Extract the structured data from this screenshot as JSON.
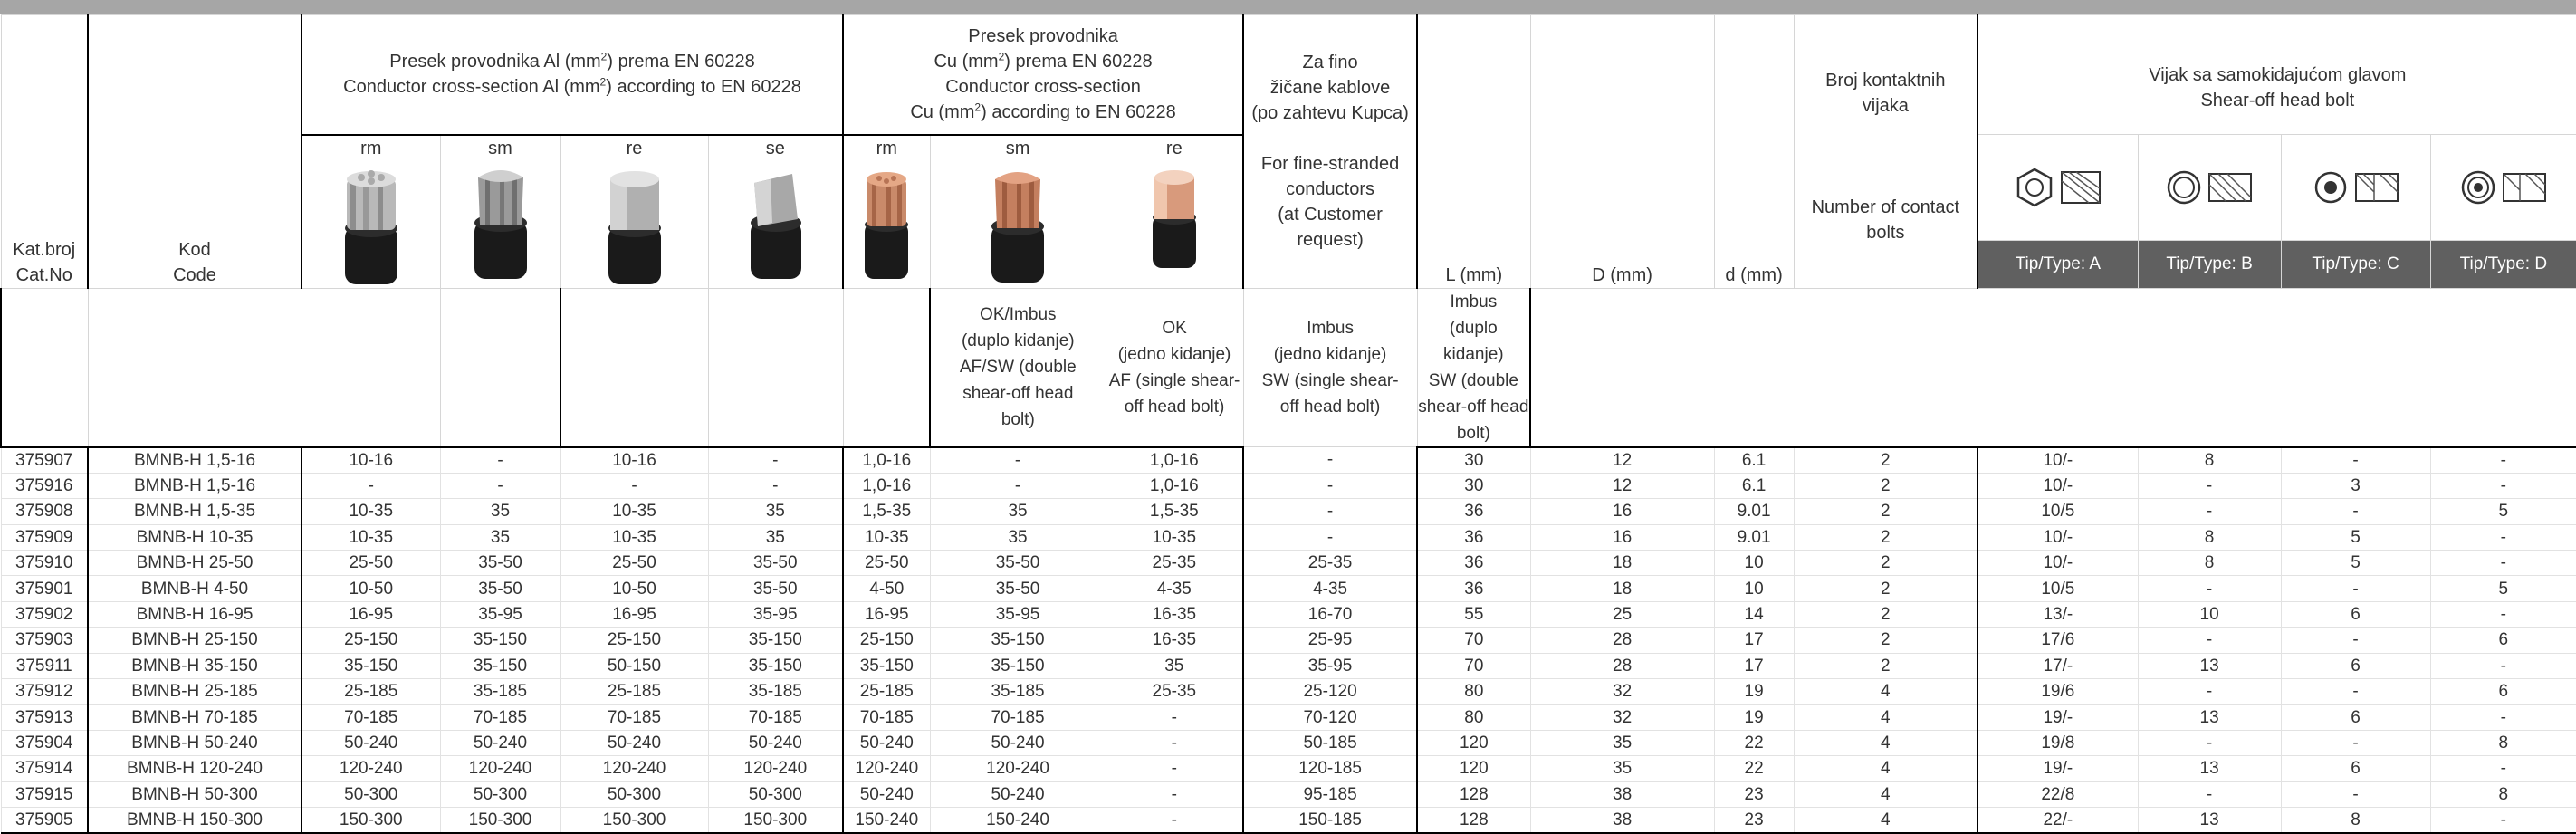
{
  "header": {
    "cat_no": "Kat.broj\nCat.No",
    "code": "Kod\nCode",
    "al_group_line1_pre": "Presek provodnika Al (mm",
    "al_group_line1_post": ") prema EN 60228",
    "al_group_line2_pre": "Conductor cross-section Al (mm",
    "al_group_line2_post": ") according to EN 60228",
    "cu_group_line1": "Presek provodnika",
    "cu_group_line2_pre": "Cu (mm",
    "cu_group_line2_post": ") prema EN 60228",
    "cu_group_line3": "Conductor cross-section",
    "cu_group_line4_pre": "Cu (mm",
    "cu_group_line4_post": ") according to EN 60228",
    "sup2": "2",
    "al_cols": [
      "rm",
      "sm",
      "re",
      "se"
    ],
    "cu_cols": [
      "rm",
      "sm",
      "re"
    ],
    "fine": "Za fino\nžičane kablove\n(po zahtevu Kupca)\n\nFor fine-stranded\nconductors\n(at Customer\nrequest)",
    "L": "L (mm)",
    "D": "D (mm)",
    "d": "d (mm)",
    "bolts": "Broj kontaktnih\nvijaka\n\n\n\nNumber of  contact\nbolts",
    "shear": "Vijak sa samokidajućom glavom\nShear-off head bolt",
    "tips": [
      "Tip/Type: A",
      "Tip/Type: B",
      "Tip/Type: C",
      "Tip/Type: D"
    ],
    "tip_desc": [
      "OK/Imbus\n(duplo kidanje)\nAF/SW (double\nshear-off head\nbolt)",
      "OK\n(jedno kidanje)\nAF (single shear-\noff head bolt)",
      "Imbus\n(jedno kidanje)\nSW (single shear-\noff head bolt)",
      "Imbus\n(duplo kidanje)\nSW (double\nshear-off head\nbolt)"
    ]
  },
  "rows": [
    [
      "375907",
      "BMNB-H 1,5-16",
      "10-16",
      "-",
      "10-16",
      "-",
      "1,0-16",
      "-",
      "1,0-16",
      "-",
      "30",
      "12",
      "6.1",
      "2",
      "10/-",
      "8",
      "-",
      "-"
    ],
    [
      "375916",
      "BMNB-H 1,5-16",
      "-",
      "-",
      "-",
      "-",
      "1,0-16",
      "-",
      "1,0-16",
      "-",
      "30",
      "12",
      "6.1",
      "2",
      "10/-",
      "-",
      "3",
      "-"
    ],
    [
      "375908",
      "BMNB-H 1,5-35",
      "10-35",
      "35",
      "10-35",
      "35",
      "1,5-35",
      "35",
      "1,5-35",
      "-",
      "36",
      "16",
      "9.01",
      "2",
      "10/5",
      "-",
      "-",
      "5"
    ],
    [
      "375909",
      "BMNB-H 10-35",
      "10-35",
      "35",
      "10-35",
      "35",
      "10-35",
      "35",
      "10-35",
      "-",
      "36",
      "16",
      "9.01",
      "2",
      "10/-",
      "8",
      "5",
      "-"
    ],
    [
      "375910",
      "BMNB-H 25-50",
      "25-50",
      "35-50",
      "25-50",
      "35-50",
      "25-50",
      "35-50",
      "25-35",
      "25-35",
      "36",
      "18",
      "10",
      "2",
      "10/-",
      "8",
      "5",
      "-"
    ],
    [
      "375901",
      "BMNB-H 4-50",
      "10-50",
      "35-50",
      "10-50",
      "35-50",
      "4-50",
      "35-50",
      "4-35",
      "4-35",
      "36",
      "18",
      "10",
      "2",
      "10/5",
      "-",
      "-",
      "5"
    ],
    [
      "375902",
      "BMNB-H 16-95",
      "16-95",
      "35-95",
      "16-95",
      "35-95",
      "16-95",
      "35-95",
      "16-35",
      "16-70",
      "55",
      "25",
      "14",
      "2",
      "13/-",
      "10",
      "6",
      "-"
    ],
    [
      "375903",
      "BMNB-H 25-150",
      "25-150",
      "35-150",
      "25-150",
      "35-150",
      "25-150",
      "35-150",
      "16-35",
      "25-95",
      "70",
      "28",
      "17",
      "2",
      "17/6",
      "-",
      "-",
      "6"
    ],
    [
      "375911",
      "BMNB-H 35-150",
      "35-150",
      "35-150",
      "50-150",
      "35-150",
      "35-150",
      "35-150",
      "35",
      "35-95",
      "70",
      "28",
      "17",
      "2",
      "17/-",
      "13",
      "6",
      "-"
    ],
    [
      "375912",
      "BMNB-H 25-185",
      "25-185",
      "35-185",
      "25-185",
      "35-185",
      "25-185",
      "35-185",
      "25-35",
      "25-120",
      "80",
      "32",
      "19",
      "4",
      "19/6",
      "-",
      "-",
      "6"
    ],
    [
      "375913",
      "BMNB-H 70-185",
      "70-185",
      "70-185",
      "70-185",
      "70-185",
      "70-185",
      "70-185",
      "-",
      "70-120",
      "80",
      "32",
      "19",
      "4",
      "19/-",
      "13",
      "6",
      "-"
    ],
    [
      "375904",
      "BMNB-H 50-240",
      "50-240",
      "50-240",
      "50-240",
      "50-240",
      "50-240",
      "50-240",
      "-",
      "50-185",
      "120",
      "35",
      "22",
      "4",
      "19/8",
      "-",
      "-",
      "8"
    ],
    [
      "375914",
      "BMNB-H 120-240",
      "120-240",
      "120-240",
      "120-240",
      "120-240",
      "120-240",
      "120-240",
      "-",
      "120-185",
      "120",
      "35",
      "22",
      "4",
      "19/-",
      "13",
      "6",
      "-"
    ],
    [
      "375915",
      "BMNB-H 50-300",
      "50-300",
      "50-300",
      "50-300",
      "50-300",
      "50-240",
      "50-240",
      "-",
      "95-185",
      "128",
      "38",
      "23",
      "4",
      "22/8",
      "-",
      "-",
      "8"
    ],
    [
      "375905",
      "BMNB-H 150-300",
      "150-300",
      "150-300",
      "150-300",
      "150-300",
      "150-240",
      "150-240",
      "-",
      "150-185",
      "128",
      "38",
      "23",
      "4",
      "22/-",
      "13",
      "8",
      "-"
    ]
  ],
  "colors": {
    "header_bar": "#a6a6a6",
    "tip_bar": "#606060",
    "aluminium": "#c8c8c8",
    "copper": "#c98a6a",
    "insulation": "#1a1a1a"
  },
  "icons": [
    "connector-al-rm-icon",
    "connector-al-sm-icon",
    "connector-al-re-icon",
    "connector-al-se-icon",
    "connector-cu-rm-icon",
    "connector-cu-sm-icon",
    "connector-cu-re-icon",
    "bolt-type-a-icon",
    "bolt-type-b-icon",
    "bolt-type-c-icon",
    "bolt-type-d-icon"
  ]
}
